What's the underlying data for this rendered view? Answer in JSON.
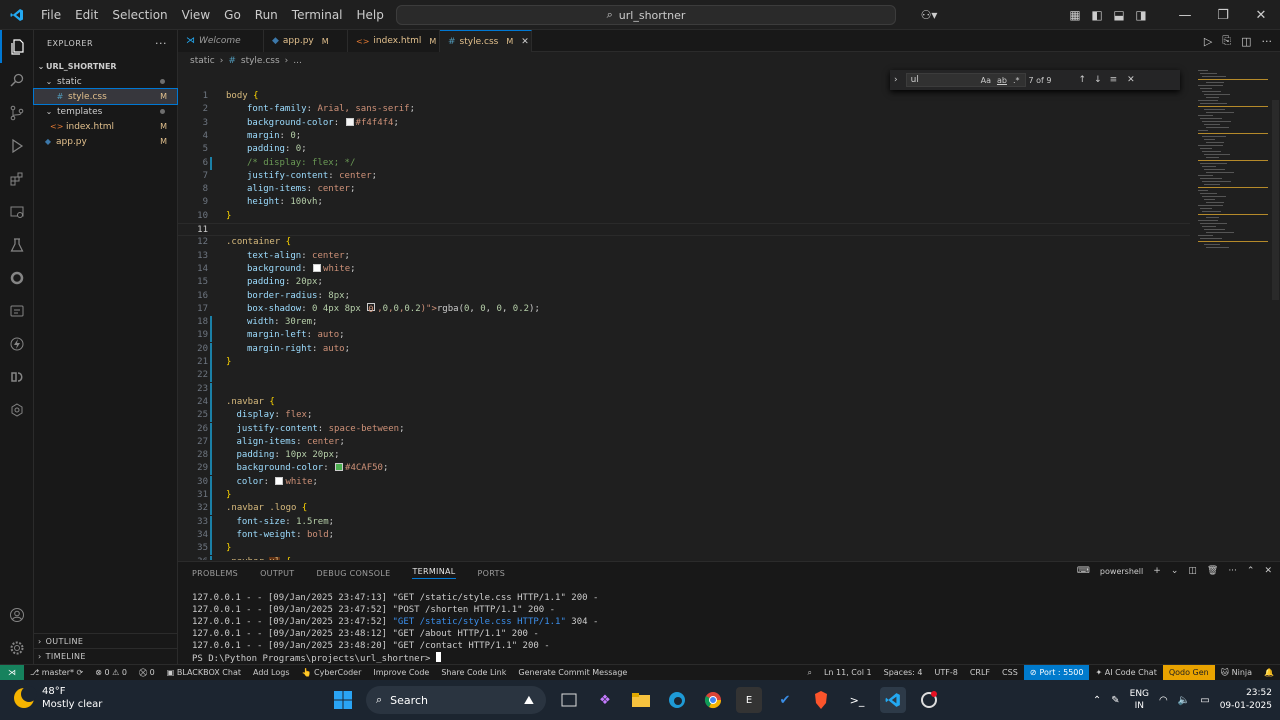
{
  "titlebar": {
    "menu": [
      "File",
      "Edit",
      "Selection",
      "View",
      "Go",
      "Run",
      "Terminal",
      "Help"
    ],
    "search_text": "url_shortner"
  },
  "explorer": {
    "header": "EXPLORER",
    "root": "URL_SHORTNER",
    "items": [
      {
        "label": "static",
        "type": "folder",
        "status": "dot"
      },
      {
        "label": "style.css",
        "type": "css",
        "status": "M"
      },
      {
        "label": "templates",
        "type": "folder",
        "status": "dot"
      },
      {
        "label": "index.html",
        "type": "html",
        "status": "M"
      },
      {
        "label": "app.py",
        "type": "py",
        "status": "M"
      }
    ],
    "outline": "OUTLINE",
    "timeline": "TIMELINE"
  },
  "tabs": [
    {
      "label": "Welcome",
      "mod": ""
    },
    {
      "label": "app.py",
      "mod": "M"
    },
    {
      "label": "index.html",
      "mod": "M"
    },
    {
      "label": "style.css",
      "mod": "M"
    }
  ],
  "breadcrumb": [
    "static",
    "style.css",
    "..."
  ],
  "find": {
    "query": "ul",
    "count": "7 of 9",
    "case": "Aa",
    "word": "ab",
    "regex": ".*"
  },
  "code_lines": [
    {
      "n": "1",
      "text": "body {"
    },
    {
      "n": "2",
      "text": "font-family: Arial, sans-serif;"
    },
    {
      "n": "3",
      "text": "background-color: #f4f4f4;"
    },
    {
      "n": "4",
      "text": "margin: 0;"
    },
    {
      "n": "5",
      "text": "padding: 0;"
    },
    {
      "n": "6",
      "text": "/* display: flex; */"
    },
    {
      "n": "7",
      "text": "justify-content: center;"
    },
    {
      "n": "8",
      "text": "align-items: center;"
    },
    {
      "n": "9",
      "text": "height: 100vh;"
    },
    {
      "n": "10",
      "text": "}"
    },
    {
      "n": "11",
      "text": ""
    },
    {
      "n": "12",
      "text": ".container {"
    },
    {
      "n": "13",
      "text": "text-align: center;"
    },
    {
      "n": "14",
      "text": "background: white;"
    },
    {
      "n": "15",
      "text": "padding: 20px;"
    },
    {
      "n": "16",
      "text": "border-radius: 8px;"
    },
    {
      "n": "17",
      "text": "box-shadow: 0 4px 8px rgba(0, 0, 0, 0.2);"
    },
    {
      "n": "18",
      "text": "width: 30rem;"
    },
    {
      "n": "19",
      "text": "margin-left: auto;"
    },
    {
      "n": "20",
      "text": "margin-right: auto;"
    },
    {
      "n": "21",
      "text": "}"
    },
    {
      "n": "22",
      "text": ""
    },
    {
      "n": "23",
      "text": ""
    },
    {
      "n": "24",
      "text": ".navbar {"
    },
    {
      "n": "25",
      "text": "display: flex;"
    },
    {
      "n": "26",
      "text": "justify-content: space-between;"
    },
    {
      "n": "27",
      "text": "align-items: center;"
    },
    {
      "n": "28",
      "text": "padding: 10px 20px;"
    },
    {
      "n": "29",
      "text": "background-color: #4CAF50;"
    },
    {
      "n": "30",
      "text": "color: white;"
    },
    {
      "n": "31",
      "text": "}"
    },
    {
      "n": "32",
      "text": ".navbar .logo {"
    },
    {
      "n": "33",
      "text": "font-size: 1.5rem;"
    },
    {
      "n": "34",
      "text": "font-weight: bold;"
    },
    {
      "n": "35",
      "text": "}"
    },
    {
      "n": "36",
      "text": ".navbar ul {"
    }
  ],
  "panel": {
    "tabs": [
      "PROBLEMS",
      "OUTPUT",
      "DEBUG CONSOLE",
      "TERMINAL",
      "PORTS"
    ],
    "shell": "powershell",
    "lines": [
      "127.0.0.1 - - [09/Jan/2025 23:47:13] \"GET /static/style.css HTTP/1.1\" 200 -",
      "127.0.0.1 - - [09/Jan/2025 23:47:52] \"POST /shorten HTTP/1.1\" 200 -",
      "127.0.0.1 - - [09/Jan/2025 23:47:52] \"GET /static/style.css HTTP/1.1\" 304 -",
      "127.0.0.1 - - [09/Jan/2025 23:48:12] \"GET /about HTTP/1.1\" 200 -",
      "127.0.0.1 - - [09/Jan/2025 23:48:20] \"GET /contact HTTP/1.1\" 200 -",
      "PS D:\\Python Programs\\projects\\url_shortner> "
    ]
  },
  "statusbar": {
    "branch": "master*",
    "errors": "0",
    "warnings": "0",
    "ports": "0",
    "left_items": [
      "BLACKBOX Chat",
      "Add Logs",
      "CyberCoder",
      "Improve Code",
      "Share Code Link",
      "Generate Commit Message"
    ],
    "position": "Ln 11, Col 1",
    "spaces": "Spaces: 4",
    "encoding": "UTF-8",
    "eol": "CRLF",
    "language": "CSS",
    "port": "Port : 5500",
    "ai_chat": "AI Code Chat",
    "qodo": "Qodo Gen",
    "ninja": "Ninja"
  },
  "taskbar": {
    "temp": "48°F",
    "weather": "Mostly clear",
    "search": "Search",
    "lang1": "ENG",
    "lang2": "IN",
    "time": "23:52",
    "date": "09-01-2025"
  },
  "colors": {
    "accent": "#0078d4",
    "remote": "#16825d",
    "statusPort": "#007acc",
    "qodo": "#e9a300",
    "navbarGreen": "#4CAF50"
  }
}
